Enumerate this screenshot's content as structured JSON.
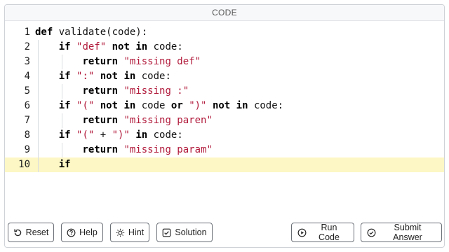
{
  "header": {
    "title": "CODE"
  },
  "editor": {
    "active_line": 10,
    "lines": [
      {
        "num": "1",
        "tokens": [
          [
            "kw",
            "def"
          ],
          [
            "pl",
            " validate(code):"
          ]
        ],
        "indent": 0
      },
      {
        "num": "2",
        "tokens": [
          [
            "pl",
            "    "
          ],
          [
            "kw",
            "if"
          ],
          [
            "pl",
            " "
          ],
          [
            "str",
            "\"def\""
          ],
          [
            "pl",
            " "
          ],
          [
            "kw",
            "not in"
          ],
          [
            "pl",
            " code:"
          ]
        ],
        "indent": 1
      },
      {
        "num": "3",
        "tokens": [
          [
            "pl",
            "        "
          ],
          [
            "kw",
            "return"
          ],
          [
            "pl",
            " "
          ],
          [
            "str",
            "\"missing def\""
          ]
        ],
        "indent": 2
      },
      {
        "num": "4",
        "tokens": [
          [
            "pl",
            "    "
          ],
          [
            "kw",
            "if"
          ],
          [
            "pl",
            " "
          ],
          [
            "str",
            "\":\""
          ],
          [
            "pl",
            " "
          ],
          [
            "kw",
            "not in"
          ],
          [
            "pl",
            " code:"
          ]
        ],
        "indent": 1
      },
      {
        "num": "5",
        "tokens": [
          [
            "pl",
            "        "
          ],
          [
            "kw",
            "return"
          ],
          [
            "pl",
            " "
          ],
          [
            "str",
            "\"missing :\""
          ]
        ],
        "indent": 2
      },
      {
        "num": "6",
        "tokens": [
          [
            "pl",
            "    "
          ],
          [
            "kw",
            "if"
          ],
          [
            "pl",
            " "
          ],
          [
            "str",
            "\"(\""
          ],
          [
            "pl",
            " "
          ],
          [
            "kw",
            "not in"
          ],
          [
            "pl",
            " code "
          ],
          [
            "kw",
            "or"
          ],
          [
            "pl",
            " "
          ],
          [
            "str",
            "\")\""
          ],
          [
            "pl",
            " "
          ],
          [
            "kw",
            "not in"
          ],
          [
            "pl",
            " code:"
          ]
        ],
        "indent": 1
      },
      {
        "num": "7",
        "tokens": [
          [
            "pl",
            "        "
          ],
          [
            "kw",
            "return"
          ],
          [
            "pl",
            " "
          ],
          [
            "str",
            "\"missing paren\""
          ]
        ],
        "indent": 2
      },
      {
        "num": "8",
        "tokens": [
          [
            "pl",
            "    "
          ],
          [
            "kw",
            "if"
          ],
          [
            "pl",
            " "
          ],
          [
            "str",
            "\"(\""
          ],
          [
            "pl",
            " + "
          ],
          [
            "str",
            "\")\""
          ],
          [
            "pl",
            " "
          ],
          [
            "kw",
            "in"
          ],
          [
            "pl",
            " code:"
          ]
        ],
        "indent": 1
      },
      {
        "num": "9",
        "tokens": [
          [
            "pl",
            "        "
          ],
          [
            "kw",
            "return"
          ],
          [
            "pl",
            " "
          ],
          [
            "str",
            "\"missing param\""
          ]
        ],
        "indent": 2
      },
      {
        "num": "10",
        "tokens": [
          [
            "pl",
            "    "
          ],
          [
            "kw",
            "if"
          ]
        ],
        "indent": 1
      }
    ]
  },
  "footer": {
    "reset_label": "Reset",
    "help_label": "Help",
    "hint_label": "Hint",
    "solution_label": "Solution",
    "run_label": "Run Code",
    "submit_label": "Submit Answer"
  },
  "colors": {
    "keyword": "#000000",
    "string": "#b11a3b",
    "active_line": "#fcf7c4",
    "border": "#6a6f76"
  }
}
